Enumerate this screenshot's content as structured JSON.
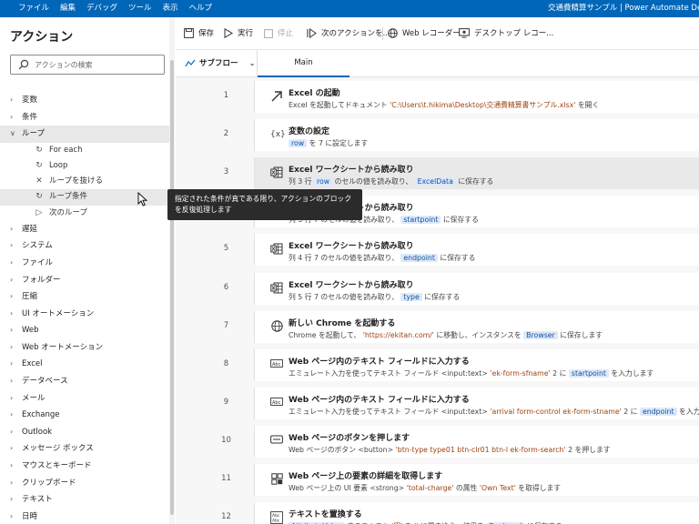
{
  "titlebar": {
    "menu": [
      "ファイル",
      "編集",
      "デバッグ",
      "ツール",
      "表示",
      "ヘルプ"
    ],
    "title": "交通費精算サンプル | Power Automate Deskto"
  },
  "sidebar": {
    "heading": "アクション",
    "search_placeholder": "アクションの検索",
    "categories_top": [
      "変数",
      "条件"
    ],
    "open_category": "ループ",
    "loop_items": [
      {
        "label": "For each",
        "icon": "loop-icon"
      },
      {
        "label": "Loop",
        "icon": "loop-icon"
      },
      {
        "label": "ループを抜ける",
        "icon": "close-icon"
      },
      {
        "label": "ループ条件",
        "icon": "loop-icon"
      },
      {
        "label": "次のループ",
        "icon": "next-icon"
      }
    ],
    "categories_bottom": [
      "遅延",
      "システム",
      "ファイル",
      "フォルダー",
      "圧縮",
      "UI オートメーション",
      "Web",
      "Web オートメーション",
      "Excel",
      "データベース",
      "メール",
      "Exchange",
      "Outlook",
      "メッセージ ボックス",
      "マウスとキーボード",
      "クリップボード",
      "テキスト",
      "日時"
    ]
  },
  "toolbar": {
    "save": "保存",
    "run": "実行",
    "stop": "停止",
    "next_action": "次のアクションを...",
    "web_recorder": "Web レコーダー",
    "desktop_recorder": "デスクトップ レコー..."
  },
  "tabs": {
    "subflow": "サブフロー",
    "main": "Main"
  },
  "tooltip": "指定された条件が真である限り、アクションのブロックを反復処理します",
  "actions": [
    {
      "num": "1",
      "icon": "arrow-up-right-icon",
      "title": "Excel の起動",
      "desc": [
        {
          "t": "Excel を起動してドキュメント "
        },
        {
          "s": "'C:\\Users\\t.hikima\\Desktop\\交通費精算書サンプル.xlsx'"
        },
        {
          "t": " を開く"
        }
      ]
    },
    {
      "num": "2",
      "icon": "variable-icon",
      "title": "変数の設定",
      "desc": [
        {
          "k": "row"
        },
        {
          "t": " を 7 に設定します"
        }
      ]
    },
    {
      "num": "3",
      "icon": "excel-icon",
      "title": "Excel ワークシートから読み取り",
      "desc": [
        {
          "t": "列 3 行 "
        },
        {
          "k": "row"
        },
        {
          "t": " のセルの値を読み取り、 "
        },
        {
          "k": "ExcelData"
        },
        {
          "t": " に保存する"
        }
      ]
    },
    {
      "num": "4",
      "icon": "excel-icon",
      "title": "Excel ワークシートから読み取り",
      "desc": [
        {
          "t": "列 3 行 7 のセルの値を読み取り、 "
        },
        {
          "k": "startpoint"
        },
        {
          "t": " に保存する"
        }
      ]
    },
    {
      "num": "5",
      "icon": "excel-icon",
      "title": "Excel ワークシートから読み取り",
      "desc": [
        {
          "t": "列 4 行 7 のセルの値を読み取り、 "
        },
        {
          "k": "endpoint"
        },
        {
          "t": " に保存する"
        }
      ]
    },
    {
      "num": "6",
      "icon": "excel-icon",
      "title": "Excel ワークシートから読み取り",
      "desc": [
        {
          "t": "列 5 行 7 のセルの値を読み取り、 "
        },
        {
          "k": "type"
        },
        {
          "t": " に保存する"
        }
      ]
    },
    {
      "num": "7",
      "icon": "globe-icon",
      "title": "新しい Chrome を起動する",
      "desc": [
        {
          "t": "Chrome を起動して、 "
        },
        {
          "s": "'https://ekitan.com/'"
        },
        {
          "t": " に移動し、インスタンスを "
        },
        {
          "k": "Browser"
        },
        {
          "t": " に保存します"
        }
      ]
    },
    {
      "num": "8",
      "icon": "textfield-icon",
      "title": "Web ページ内のテキスト フィールドに入力する",
      "desc": [
        {
          "t": "エミュレート入力を使ってテキスト フィールド <input:text> "
        },
        {
          "s": "'ek-form-sfname'"
        },
        {
          "t": " 2 に "
        },
        {
          "k": "startpoint"
        },
        {
          "t": " を入力します"
        }
      ]
    },
    {
      "num": "9",
      "icon": "textfield-icon",
      "title": "Web ページ内のテキスト フィールドに入力する",
      "desc": [
        {
          "t": "エミュレート入力を使ってテキスト フィールド <input:text> "
        },
        {
          "s": "'arrival form-control ek-form-stname'"
        },
        {
          "t": " 2 に "
        },
        {
          "k": "endpoint"
        },
        {
          "t": " を入力します"
        }
      ]
    },
    {
      "num": "10",
      "icon": "button-icon",
      "title": "Web ページのボタンを押します",
      "desc": [
        {
          "t": "Web ページのボタン <button> "
        },
        {
          "s": "'btn-type type01 btn-clr01 btn-l ek-form-search'"
        },
        {
          "t": " 2 を押します"
        }
      ]
    },
    {
      "num": "11",
      "icon": "element-details-icon",
      "title": "Web ページ上の要素の詳細を取得します",
      "desc": [
        {
          "t": "Web ページ上の UI 要素 <strong> "
        },
        {
          "s": "'total-charge'"
        },
        {
          "t": " の属性 "
        },
        {
          "s": "'Own Text'"
        },
        {
          "t": " を取得します"
        }
      ]
    },
    {
      "num": "12",
      "icon": "text-replace-icon",
      "title": "テキストを置換する",
      "desc": [
        {
          "k": "AttributeValue"
        },
        {
          "t": " 内のテキスト "
        },
        {
          "s": "'円'"
        },
        {
          "t": " を '' に置き換え、結果を "
        },
        {
          "k": "Replaced"
        },
        {
          "t": " に保存する"
        }
      ]
    }
  ]
}
